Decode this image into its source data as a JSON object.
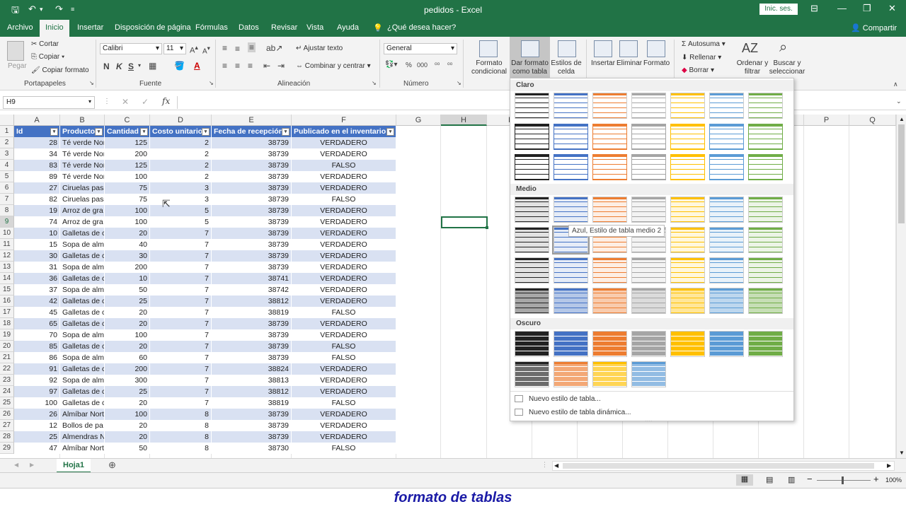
{
  "window": {
    "title": "pedidos - Excel",
    "signin": "Inic. ses.",
    "share": "Compartir"
  },
  "tabs": [
    "Archivo",
    "Inicio",
    "Insertar",
    "Disposición de página",
    "Fórmulas",
    "Datos",
    "Revisar",
    "Vista",
    "Ayuda",
    "¿Qué desea hacer?"
  ],
  "ribbon": {
    "clipboard": {
      "paste": "Pegar",
      "cut": "Cortar",
      "copy": "Copiar",
      "format_painter": "Copiar formato",
      "label": "Portapapeles"
    },
    "font": {
      "name": "Calibri",
      "size": "11",
      "label": "Fuente",
      "bold": "N",
      "italic": "K",
      "underline": "S"
    },
    "alignment": {
      "wrap": "Ajustar texto",
      "merge": "Combinar y centrar",
      "label": "Alineación"
    },
    "number": {
      "format": "General",
      "label": "Número"
    },
    "styles": {
      "conditional": "Formato condicional",
      "as_table": "Dar formato como tabla",
      "cell_styles": "Estilos de celda"
    },
    "cells": {
      "insert": "Insertar",
      "delete": "Eliminar",
      "format": "Formato"
    },
    "editing": {
      "autosum": "Autosuma",
      "fill": "Rellenar",
      "clear": "Borrar",
      "sort": "Ordenar y filtrar",
      "find": "Buscar y seleccionar"
    }
  },
  "formula_bar": {
    "name_box": "H9",
    "formula": ""
  },
  "columns": [
    "A",
    "B",
    "C",
    "D",
    "E",
    "F",
    "G",
    "H",
    "I",
    "J",
    "K",
    "L",
    "M",
    "N",
    "O",
    "P",
    "Q"
  ],
  "table_headers": [
    "Id",
    "Producto",
    "Cantidad",
    "Costo unitario",
    "Fecha de recepción",
    "Publicado en el inventario"
  ],
  "rows": [
    [
      "28",
      "Té verde Nor",
      "125",
      "2",
      "38739",
      "VERDADERO"
    ],
    [
      "34",
      "Té verde Nor",
      "200",
      "2",
      "38739",
      "VERDADERO"
    ],
    [
      "83",
      "Té verde Nor",
      "125",
      "2",
      "38739",
      "FALSO"
    ],
    [
      "89",
      "Té verde Nor",
      "100",
      "2",
      "38739",
      "VERDADERO"
    ],
    [
      "27",
      "Ciruelas pasa",
      "75",
      "3",
      "38739",
      "VERDADERO"
    ],
    [
      "82",
      "Ciruelas pasa",
      "75",
      "3",
      "38739",
      "FALSO"
    ],
    [
      "19",
      "Arroz de gra",
      "100",
      "5",
      "38739",
      "VERDADERO"
    ],
    [
      "74",
      "Arroz de gra",
      "100",
      "5",
      "38739",
      "VERDADERO"
    ],
    [
      "10",
      "Galletas de c",
      "20",
      "7",
      "38739",
      "VERDADERO"
    ],
    [
      "15",
      "Sopa de alm",
      "40",
      "7",
      "38739",
      "VERDADERO"
    ],
    [
      "30",
      "Galletas de c",
      "30",
      "7",
      "38739",
      "VERDADERO"
    ],
    [
      "31",
      "Sopa de alm",
      "200",
      "7",
      "38739",
      "VERDADERO"
    ],
    [
      "36",
      "Galletas de c",
      "10",
      "7",
      "38741",
      "VERDADERO"
    ],
    [
      "37",
      "Sopa de alm",
      "50",
      "7",
      "38742",
      "VERDADERO"
    ],
    [
      "42",
      "Galletas de c",
      "25",
      "7",
      "38812",
      "VERDADERO"
    ],
    [
      "45",
      "Galletas de c",
      "20",
      "7",
      "38819",
      "FALSO"
    ],
    [
      "65",
      "Galletas de c",
      "20",
      "7",
      "38739",
      "VERDADERO"
    ],
    [
      "70",
      "Sopa de alm",
      "100",
      "7",
      "38739",
      "VERDADERO"
    ],
    [
      "85",
      "Galletas de c",
      "20",
      "7",
      "38739",
      "FALSO"
    ],
    [
      "86",
      "Sopa de alm",
      "60",
      "7",
      "38739",
      "FALSO"
    ],
    [
      "91",
      "Galletas de c",
      "200",
      "7",
      "38824",
      "VERDADERO"
    ],
    [
      "92",
      "Sopa de alm",
      "300",
      "7",
      "38813",
      "VERDADERO"
    ],
    [
      "97",
      "Galletas de c",
      "25",
      "7",
      "38812",
      "VERDADERO"
    ],
    [
      "100",
      "Galletas de c",
      "20",
      "7",
      "38819",
      "FALSO"
    ],
    [
      "26",
      "Almíbar Nort",
      "100",
      "8",
      "38739",
      "VERDADERO"
    ],
    [
      "12",
      "Bollos de pa",
      "20",
      "8",
      "38739",
      "VERDADERO"
    ],
    [
      "25",
      "Almendras N",
      "20",
      "8",
      "38739",
      "VERDADERO"
    ],
    [
      "47",
      "Almíbar Nort",
      "50",
      "8",
      "38730",
      "FALSO"
    ]
  ],
  "gallery": {
    "sections": [
      "Claro",
      "Medio",
      "Oscuro"
    ],
    "tooltip": "Azul, Estilo de tabla medio 2",
    "new_table_style": "Nuevo estilo de tabla...",
    "new_pivot_style": "Nuevo estilo de tabla dinámica...",
    "palette": [
      "#222222",
      "#4472c4",
      "#ed7d31",
      "#a5a5a5",
      "#ffc000",
      "#5b9bd5",
      "#70ad47"
    ]
  },
  "sheet_tab": "Hoja1",
  "zoom": "100%",
  "caption": "formato de tablas"
}
